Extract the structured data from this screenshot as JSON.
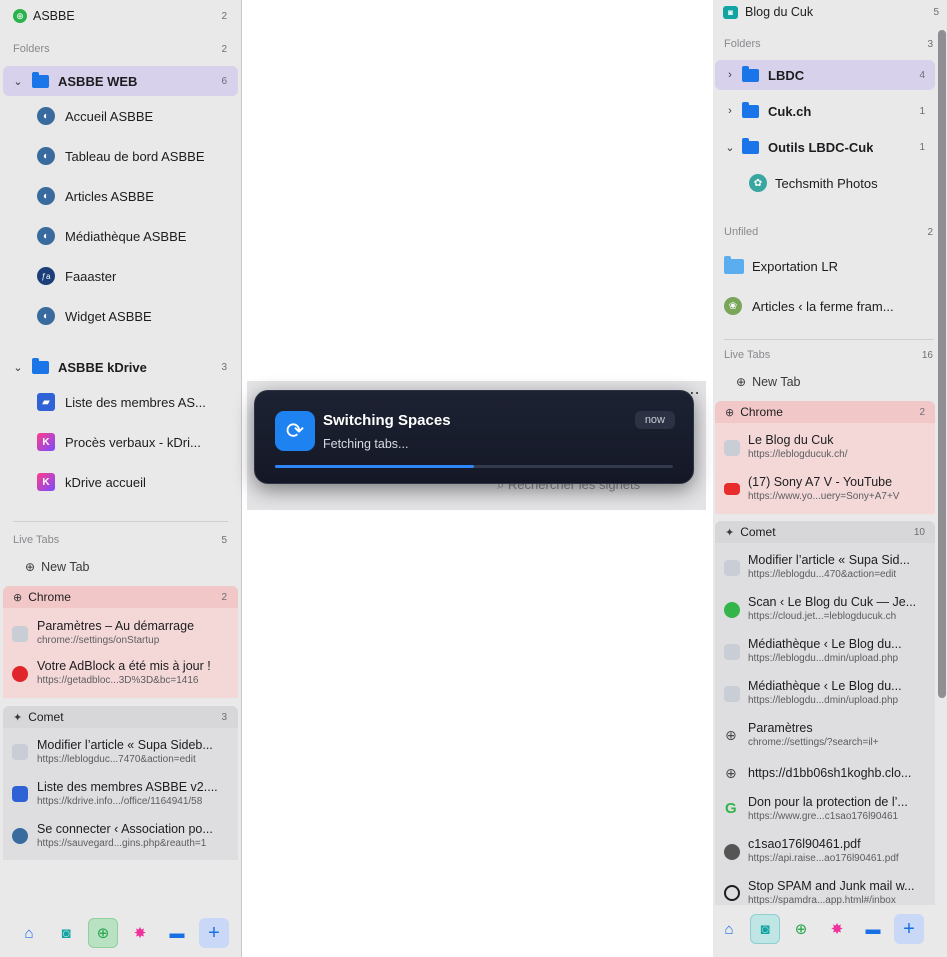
{
  "left": {
    "space_name": "ASBBE",
    "space_count": "2",
    "folders_header": "Folders",
    "folders_count": "2",
    "folder1": {
      "label": "ASBBE WEB",
      "count": "6",
      "items": [
        "Accueil ASBBE",
        "Tableau de bord ASBBE",
        "Articles ASBBE",
        "Médiathèque ASBBE",
        "Faaaster",
        "Widget ASBBE"
      ]
    },
    "folder2": {
      "label": "ASBBE kDrive",
      "count": "3",
      "items": [
        "Liste des membres AS...",
        "Procès verbaux - kDri...",
        "kDrive accueil"
      ]
    },
    "live_tabs": "Live Tabs",
    "live_count": "5",
    "new_tab": "New Tab",
    "chrome": {
      "label": "Chrome",
      "count": "2",
      "tabs": [
        {
          "title": "Paramètres – Au démarrage",
          "url": "chrome://settings/onStartup"
        },
        {
          "title": "Votre AdBlock a été mis à jour !",
          "url": "https://getadbloc...3D%3D&bc=1416"
        }
      ]
    },
    "comet": {
      "label": "Comet",
      "count": "3",
      "tabs": [
        {
          "title": "Modifier l’article « Supa Sideb...",
          "url": "https://leblogduc...7470&action=edit"
        },
        {
          "title": "Liste des membres ASBBE v2....",
          "url": "https://kdrive.info.../office/1164941/58"
        },
        {
          "title": "Se connecter ‹ Association po...",
          "url": "https://sauvegard...gins.php&reauth=1"
        }
      ]
    }
  },
  "toast": {
    "title": "Switching Spaces",
    "subtitle": "Fetching tabs...",
    "time": "now",
    "progress": 0.5
  },
  "middle": {
    "search_placeholder": "Rechercher les signets"
  },
  "right": {
    "space_name": "Blog du Cuk",
    "space_count": "5",
    "folders_header": "Folders",
    "folders_count": "3",
    "folders": [
      {
        "label": "LBDC",
        "count": "4"
      },
      {
        "label": "Cuk.ch",
        "count": "1"
      },
      {
        "label": "Outils LBDC-Cuk",
        "count": "1"
      }
    ],
    "folder_item": "Techsmith Photos",
    "unfiled": "Unfiled",
    "unfiled_count": "2",
    "unfiled_items": [
      "Exportation LR",
      "Articles ‹ la ferme fram..."
    ],
    "live_tabs": "Live Tabs",
    "live_count": "16",
    "new_tab": "New Tab",
    "chrome": {
      "label": "Chrome",
      "count": "2",
      "tabs": [
        {
          "title": "Le Blog du Cuk",
          "url": "https://leblogducuk.ch/"
        },
        {
          "title": "(17) Sony A7 V - YouTube",
          "url": "https://www.yo...uery=Sony+A7+V"
        }
      ]
    },
    "comet": {
      "label": "Comet",
      "count": "10",
      "tabs": [
        {
          "title": "Modifier l’article « Supa Sid...",
          "url": "https://leblogdu...470&action=edit"
        },
        {
          "title": "Scan ‹ Le Blog du Cuk — Je...",
          "url": "https://cloud.jet...=leblogducuk.ch"
        },
        {
          "title": "Médiathèque ‹ Le Blog du...",
          "url": "https://leblogdu...dmin/upload.php"
        },
        {
          "title": "Médiathèque ‹ Le Blog du...",
          "url": "https://leblogdu...dmin/upload.php"
        },
        {
          "title": "Paramètres",
          "url": "chrome://settings/?search=il+"
        },
        {
          "title": "https://d1bb06sh1koghb.clo...",
          "url": ""
        },
        {
          "title": "Don pour la protection de l’...",
          "url": "https://www.gre...c1sao176l90461"
        },
        {
          "title": "c1sao176l90461.pdf",
          "url": "https://api.raise...ao176l90461.pdf"
        },
        {
          "title": "Stop SPAM and Junk mail w...",
          "url": "https://spamdra...app.html#/inbox"
        }
      ]
    }
  }
}
